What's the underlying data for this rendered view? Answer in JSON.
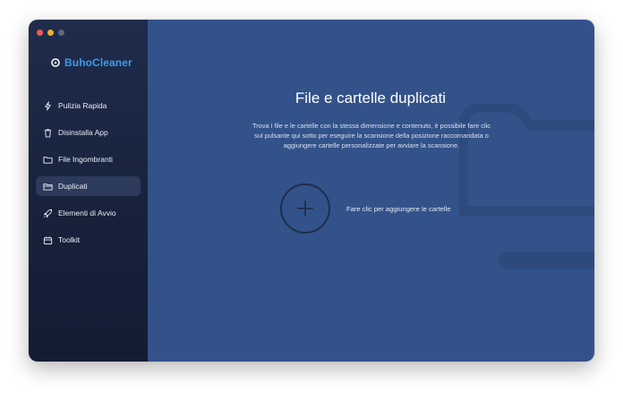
{
  "app": {
    "name": "BuhoCleaner",
    "colors": {
      "brand": "#3d9bea",
      "sidebar": "#1a2540",
      "main": "#33528a",
      "active_item": "#2c3a5b"
    }
  },
  "sidebar": {
    "items": [
      {
        "label": "Pulizia Rapida",
        "icon": "bolt-icon"
      },
      {
        "label": "Disinstalla App",
        "icon": "trash-icon"
      },
      {
        "label": "File Ingombranti",
        "icon": "folder-icon"
      },
      {
        "label": "Duplicati",
        "icon": "duplicate-folder-icon",
        "active": true
      },
      {
        "label": "Elementi di Avvio",
        "icon": "rocket-icon"
      },
      {
        "label": "Toolkit",
        "icon": "toolkit-icon"
      }
    ]
  },
  "main": {
    "title": "File e cartelle duplicati",
    "description": "Trova i file e le cartelle con la stessa dimensione e contenuto, è possibile fare clic sul pulsante qui sotto per eseguire la scansione della posizione raccomandata o aggiungere cartelle personalizzate per avviare la scansione.",
    "add_folder_label": "Fare clic per aggiungere le cartelle"
  }
}
